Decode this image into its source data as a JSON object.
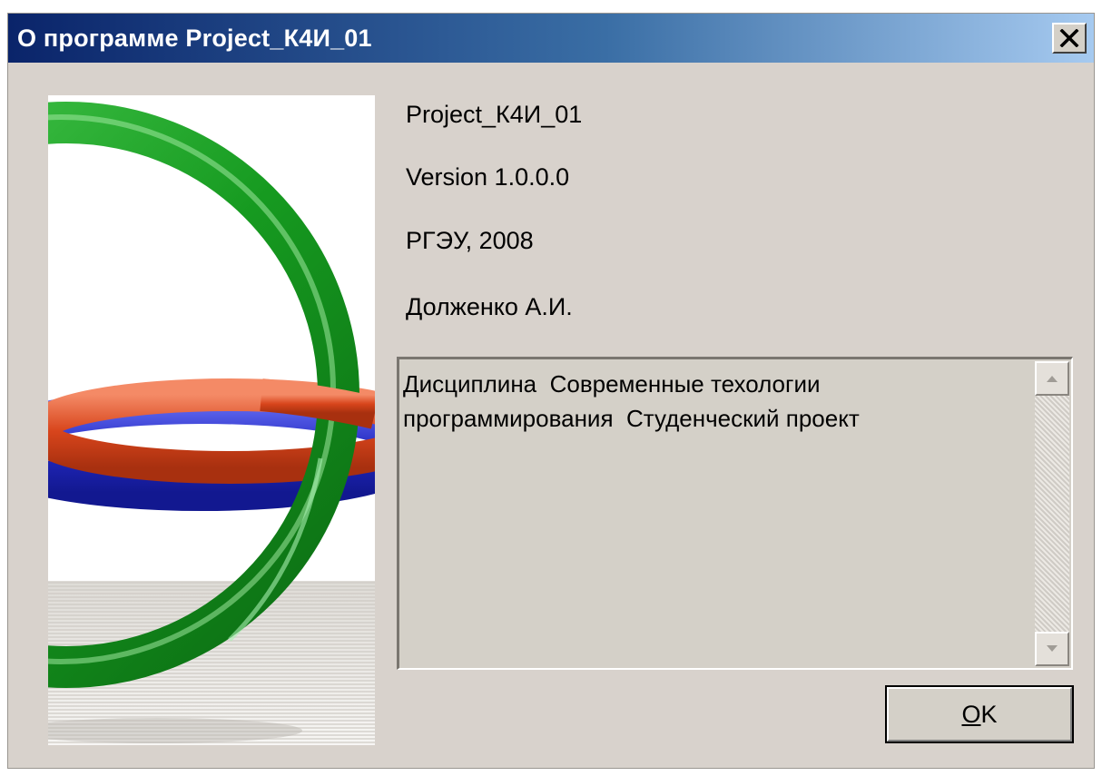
{
  "window": {
    "title": "О программе Project_К4И_01",
    "close_icon": "close-icon"
  },
  "info": {
    "product_name": "Project_К4И_01",
    "version": "Version 1.0.0.0",
    "copyright": "РГЭУ, 2008",
    "author": "Долженко А.И."
  },
  "description": {
    "text": "Дисциплина  Современные техологии программирования  Студенческий проект"
  },
  "buttons": {
    "ok_mnemonic": "O",
    "ok_rest": "K"
  },
  "colors": {
    "titlebar_start": "#0a246a",
    "titlebar_end": "#a6caf0",
    "dialog_background": "#d8d2cc",
    "logo_green": "#1e9a2a",
    "logo_orange": "#e0552a",
    "logo_blue": "#2a34c8"
  }
}
